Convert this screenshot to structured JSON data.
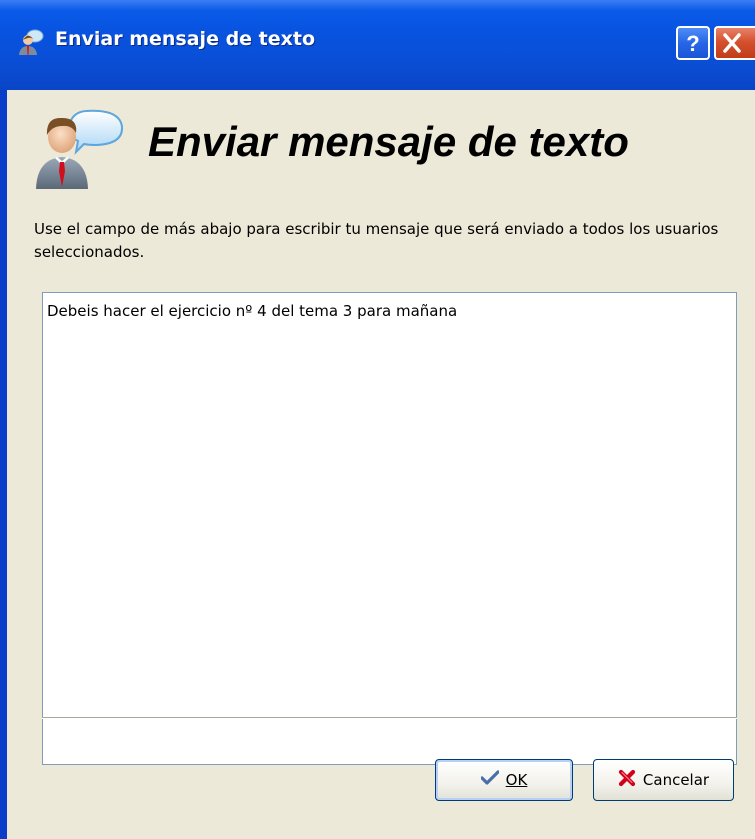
{
  "window": {
    "title": "Enviar mensaje de texto",
    "title_icon": "user-message-icon",
    "help_button_icon": "help-icon",
    "close_button_icon": "close-icon"
  },
  "header": {
    "heading": "Enviar mensaje de texto",
    "icon": "user-speech-bubble-icon"
  },
  "description": "Use el campo de más abajo para escribir tu mensaje que será enviado a todos los usuarios seleccionados.",
  "message": {
    "value": "Debeis hacer el ejercicio nº 4 del tema 3 para mañana"
  },
  "buttons": {
    "ok_label": "OK",
    "ok_icon": "checkmark-icon",
    "cancel_label": "Cancelar",
    "cancel_icon": "red-x-icon"
  },
  "colors": {
    "titlebar": "#0a4ed6",
    "client_bg": "#ece9d8",
    "close_button": "#d5512e"
  }
}
